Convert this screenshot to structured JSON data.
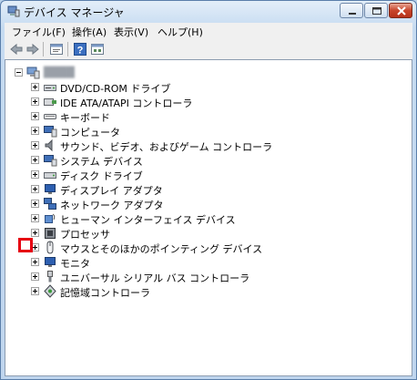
{
  "window": {
    "title": "デバイス マネージャ",
    "icon": "device-manager-icon"
  },
  "menu": {
    "file": "ファイル(F)",
    "action": "操作(A)",
    "view": "表示(V)",
    "help": "ヘルプ(H)"
  },
  "toolbar": {
    "items": [
      "back-arrow-icon",
      "forward-arrow-icon",
      "properties-icon",
      "help-icon",
      "scan-hardware-icon"
    ]
  },
  "tree": {
    "root": {
      "label": "████",
      "icon": "computer-icon"
    },
    "items": [
      {
        "label": "DVD/CD-ROM ドライブ",
        "icon": "dvd-drive-icon"
      },
      {
        "label": "IDE ATA/ATAPI コントローラ",
        "icon": "ide-controller-icon"
      },
      {
        "label": "キーボード",
        "icon": "keyboard-icon"
      },
      {
        "label": "コンピュータ",
        "icon": "computer-icon"
      },
      {
        "label": "サウンド、ビデオ、およびゲーム コントローラ",
        "icon": "speaker-icon"
      },
      {
        "label": "システム デバイス",
        "icon": "system-device-icon"
      },
      {
        "label": "ディスク ドライブ",
        "icon": "disk-drive-icon"
      },
      {
        "label": "ディスプレイ アダプタ",
        "icon": "display-adapter-icon"
      },
      {
        "label": "ネットワーク アダプタ",
        "icon": "network-adapter-icon"
      },
      {
        "label": "ヒューマン インターフェイス デバイス",
        "icon": "hid-icon"
      },
      {
        "label": "プロセッサ",
        "icon": "processor-icon"
      },
      {
        "label": "マウスとそのほかのポインティング デバイス",
        "icon": "mouse-icon"
      },
      {
        "label": "モニタ",
        "icon": "monitor-icon"
      },
      {
        "label": "ユニバーサル シリアル バス コントローラ",
        "icon": "usb-icon"
      },
      {
        "label": "記憶域コントローラ",
        "icon": "storage-controller-icon"
      }
    ],
    "highlighted_item": "マウスとそのほかのポインティング デバイス"
  },
  "colors": {
    "highlight_border": "#e60012",
    "window_frame": "#c6dbf1"
  }
}
